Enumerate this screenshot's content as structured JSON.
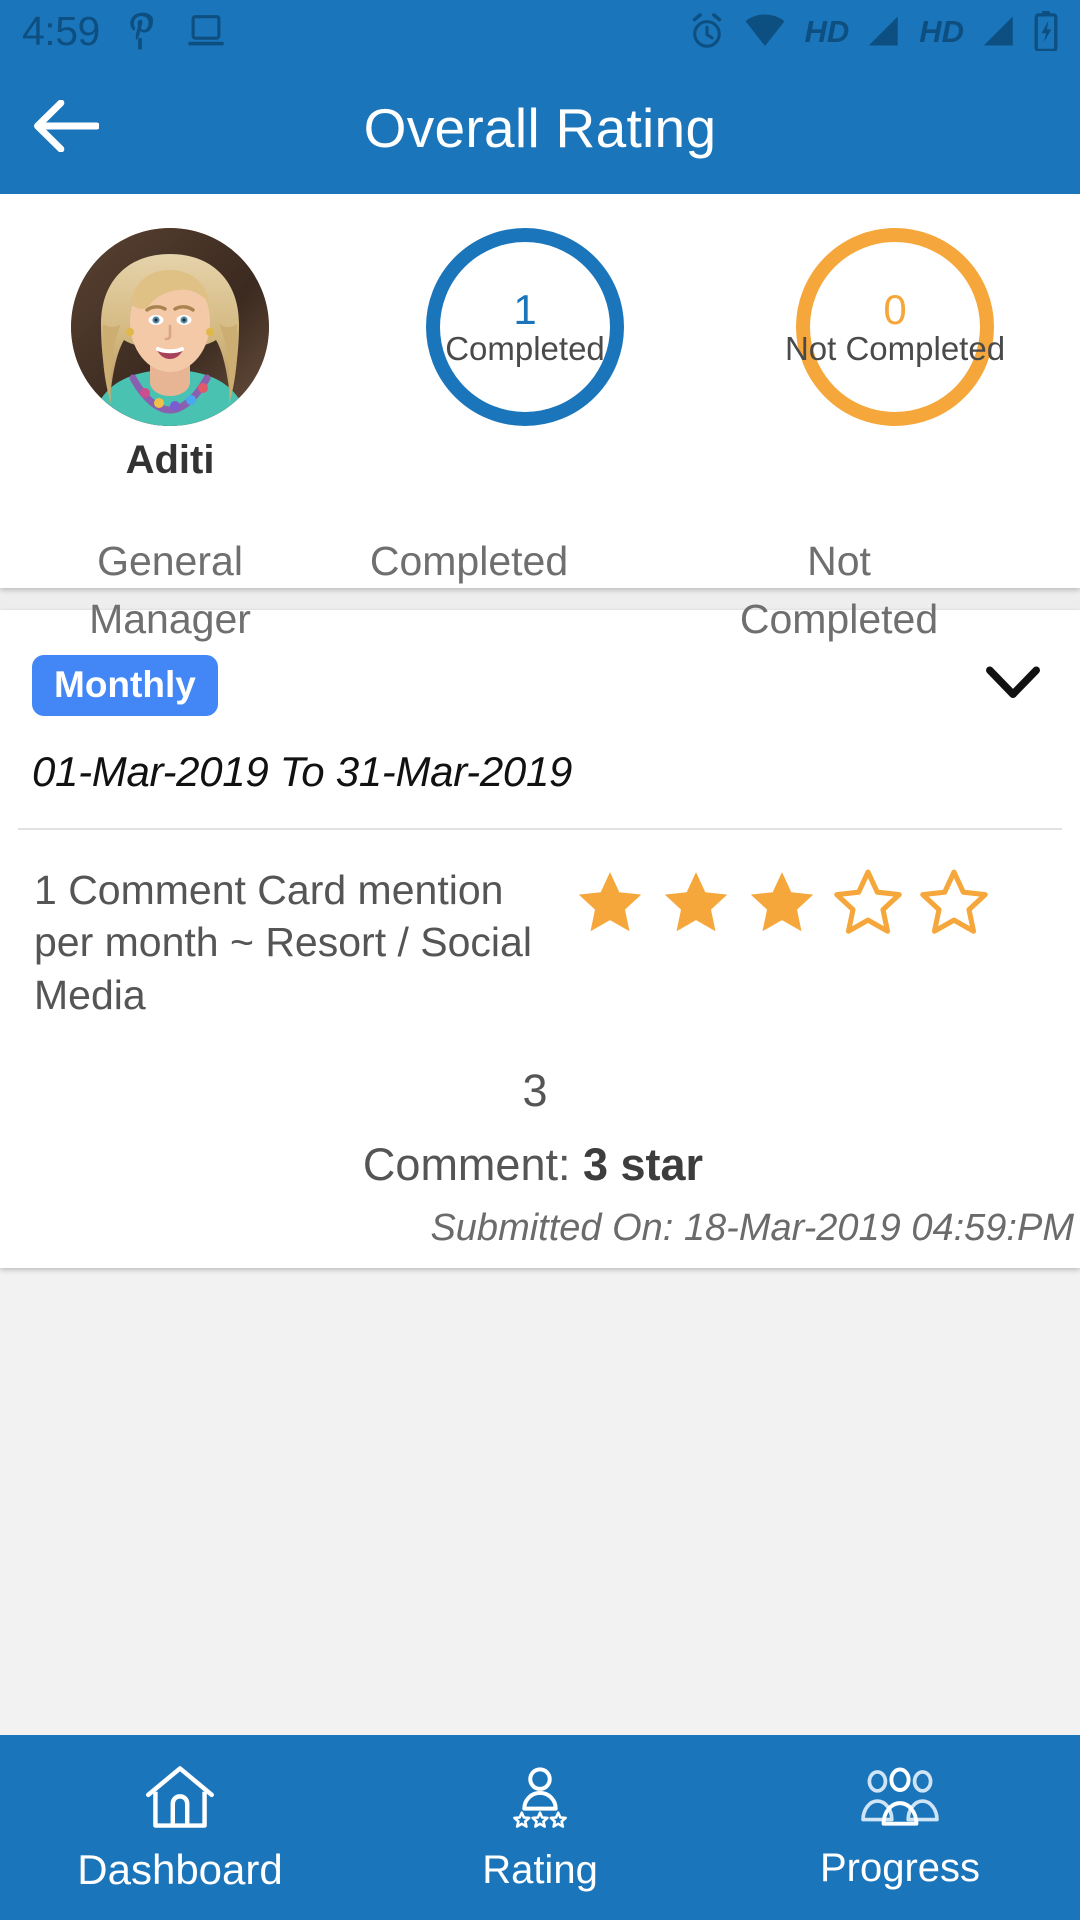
{
  "status_bar": {
    "time": "4:59",
    "left_icons": [
      "pinterest-icon",
      "laptop-icon"
    ],
    "right_icons": [
      "alarm-icon",
      "wifi-icon",
      "hd-label",
      "signal-icon",
      "hd-label",
      "signal-icon",
      "battery-charging-icon"
    ],
    "hd_label": "HD"
  },
  "app_bar": {
    "title": "Overall Rating",
    "back_icon": "arrow-left-icon"
  },
  "profile": {
    "name": "Aditi",
    "role": "General Manager",
    "avatar_alt": "user-avatar",
    "stats": [
      {
        "value": "1",
        "ring_label": "Completed",
        "caption": "Completed",
        "color": "#1b75bb"
      },
      {
        "value": "0",
        "ring_label": "Not Completed",
        "caption": "Not Completed",
        "color": "#f5a73b"
      }
    ]
  },
  "rating_card": {
    "period_badge": "Monthly",
    "expand_icon": "chevron-down-icon",
    "date_range": "01-Mar-2019 To 31-Mar-2019",
    "criteria": "1 Comment Card mention per month ~ Resort / Social Media",
    "rating_filled": 3,
    "rating_total": 5,
    "score": "3",
    "comment_label": "Comment: ",
    "comment_value": "3 star",
    "submitted": "Submitted On: 18-Mar-2019 04:59:PM"
  },
  "bottom_nav": [
    {
      "label": "Dashboard",
      "icon": "home-icon"
    },
    {
      "label": "Rating",
      "icon": "person-stars-icon"
    },
    {
      "label": "Progress",
      "icon": "people-group-icon"
    }
  ],
  "colors": {
    "primary": "#1b75bb",
    "accent_orange": "#f5a73b",
    "badge_blue": "#4287f5",
    "status_icon": "#0d4f80"
  }
}
